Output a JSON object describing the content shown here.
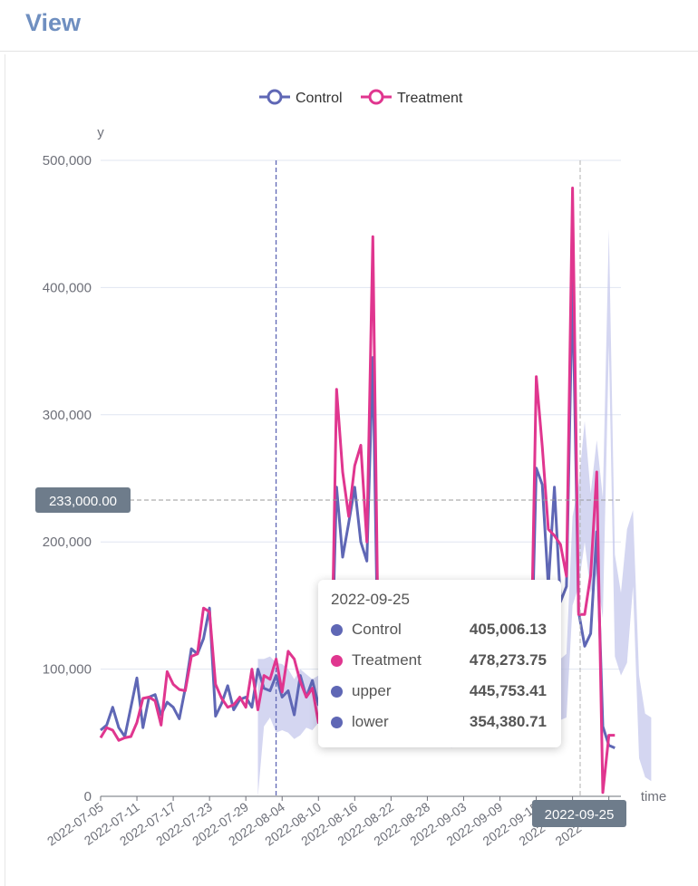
{
  "header": {
    "title": "View"
  },
  "legend": [
    {
      "name": "Control",
      "color": "#5f67b5"
    },
    {
      "name": "Treatment",
      "color": "#e0368f"
    }
  ],
  "crosshair": {
    "y_value": "233,000.00",
    "x_value": "2022-09-25"
  },
  "tooltip": {
    "date": "2022-09-25",
    "rows": [
      {
        "name": "Control",
        "value": "405,006.13",
        "color": "#5f67b5"
      },
      {
        "name": "Treatment",
        "value": "478,273.75",
        "color": "#e0368f"
      },
      {
        "name": "upper",
        "value": "445,753.41",
        "color": "#5f67b5"
      },
      {
        "name": "lower",
        "value": "354,380.71",
        "color": "#5f67b5"
      }
    ]
  },
  "chart_data": {
    "type": "line",
    "ylabel": "y",
    "xlabel": "time",
    "ylim": [
      0,
      500000
    ],
    "yticks": [
      0,
      100000,
      200000,
      300000,
      400000,
      500000
    ],
    "ytick_labels": [
      "0",
      "100,000",
      "200,000",
      "300,000",
      "400,000",
      "500,000"
    ],
    "x_start": "2022-07-05",
    "x_end": "2022-09-29",
    "xtick_labels": [
      "2022-07-05",
      "2022-07-11",
      "2022-07-17",
      "2022-07-23",
      "2022-07-29",
      "2022-08-04",
      "2022-08-10",
      "2022-08-16",
      "2022-08-22",
      "2022-08-28",
      "2022-09-03",
      "2022-09-09",
      "2022-09-15",
      "2022-09-21",
      "2022-09-27"
    ],
    "intervention_date": "2022-08-03",
    "band_start_date": "2022-07-31",
    "band_color": "#c5c8ec",
    "series": [
      {
        "name": "Control",
        "color": "#5f67b5",
        "values": [
          52000,
          56000,
          70000,
          54000,
          47000,
          70000,
          93000,
          54000,
          78000,
          80000,
          64000,
          74000,
          70000,
          61000,
          85000,
          116000,
          112000,
          124000,
          148000,
          63000,
          73000,
          87000,
          68000,
          76000,
          78000,
          70000,
          100000,
          85000,
          83000,
          95000,
          78000,
          83000,
          64000,
          95000,
          78000,
          91000,
          72000,
          74000,
          70000,
          243000,
          188000,
          215000,
          243000,
          200000,
          185000,
          345000,
          62000,
          60000,
          54000,
          53000,
          44000,
          78000,
          74000,
          68000,
          56000,
          77000,
          76000,
          66000,
          64000,
          82000,
          65000,
          84000,
          75000,
          58000,
          88000,
          100000,
          82000,
          84000,
          90000,
          70000,
          65000,
          68000,
          258000,
          245000,
          165000,
          243000,
          153000,
          165000,
          405006,
          145000,
          118000,
          128000,
          208000,
          55000,
          40000,
          38000
        ]
      },
      {
        "name": "Treatment",
        "color": "#e0368f",
        "values": [
          46000,
          54000,
          52000,
          44000,
          46000,
          47000,
          58000,
          77000,
          78000,
          75000,
          56000,
          98000,
          88000,
          84000,
          83000,
          110000,
          112000,
          148000,
          145000,
          88000,
          77000,
          70000,
          72000,
          78000,
          70000,
          100000,
          68000,
          95000,
          92000,
          108000,
          82000,
          114000,
          108000,
          90000,
          78000,
          85000,
          58000,
          75000,
          51000,
          320000,
          255000,
          220000,
          260000,
          276000,
          200000,
          440000,
          78000,
          42000,
          50000,
          65000,
          42000,
          80000,
          90000,
          70000,
          85000,
          66000,
          51000,
          65000,
          52000,
          80000,
          72000,
          85000,
          80000,
          90000,
          64000,
          53000,
          75000,
          82000,
          90000,
          70000,
          72000,
          72000,
          330000,
          275000,
          210000,
          205000,
          198000,
          173000,
          478274,
          143000,
          143000,
          174000,
          255000,
          3000,
          48000,
          48000
        ]
      }
    ],
    "band_upper": [
      108000,
      108000,
      110000,
      105000,
      104000,
      100000,
      92000,
      100000,
      96000,
      92000,
      95000,
      95000,
      105000,
      90000,
      88000,
      95000,
      92000,
      96000,
      80000,
      90000,
      98000,
      104000,
      85000,
      88000,
      94000,
      88000,
      96000,
      92000,
      90000,
      86000,
      84000,
      88000,
      85000,
      95000,
      98000,
      96000,
      100000,
      105000,
      100000,
      96000,
      94000,
      110000,
      95000,
      98000,
      100000,
      102000,
      96000,
      98000,
      100000,
      104000,
      108000,
      112000,
      220000,
      245000,
      295000,
      238000,
      280000,
      235000,
      445753,
      190000,
      160000,
      210000,
      225000,
      95000,
      65000,
      62000
    ],
    "band_lower": [
      0,
      55000,
      62000,
      50000,
      52000,
      50000,
      45000,
      48000,
      54000,
      52000,
      58000,
      50000,
      60000,
      46000,
      40000,
      55000,
      52000,
      58000,
      42000,
      48000,
      56000,
      62000,
      42000,
      44000,
      50000,
      40000,
      48000,
      52000,
      46000,
      42000,
      40000,
      44000,
      38000,
      48000,
      52000,
      50000,
      44000,
      56000,
      55000,
      52000,
      50000,
      58000,
      46000,
      52000,
      55000,
      54000,
      48000,
      50000,
      52000,
      56000,
      60000,
      62000,
      150000,
      165000,
      200000,
      160000,
      175000,
      140000,
      354381,
      110000,
      95000,
      105000,
      165000,
      30000,
      15000,
      12000
    ]
  }
}
